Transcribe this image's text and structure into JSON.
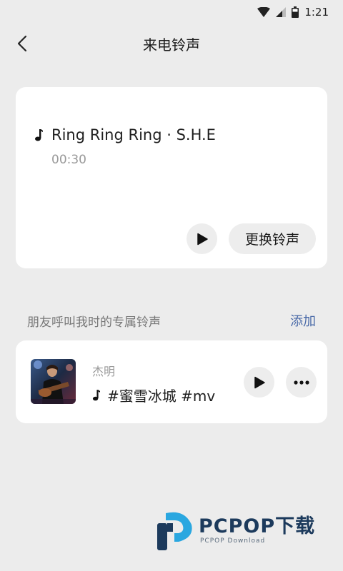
{
  "status_bar": {
    "time": "1:21"
  },
  "header": {
    "title": "来电铃声"
  },
  "ringtone_card": {
    "song_title": "Ring Ring Ring · S.H.E",
    "duration": "00:30",
    "change_label": "更换铃声"
  },
  "friends_section": {
    "title": "朋友呼叫我时的专属铃声",
    "add_label": "添加",
    "items": [
      {
        "name": "杰明",
        "song": "#蜜雪冰城 #mv"
      }
    ]
  },
  "watermark": {
    "title": "PCPOP下载",
    "subtitle": "PCPOP Download"
  },
  "colors": {
    "background": "#ececec",
    "card": "#ffffff",
    "link": "#4a6aa8",
    "watermark_blue": "#1c3a5c",
    "watermark_cyan": "#2aa7e0"
  }
}
